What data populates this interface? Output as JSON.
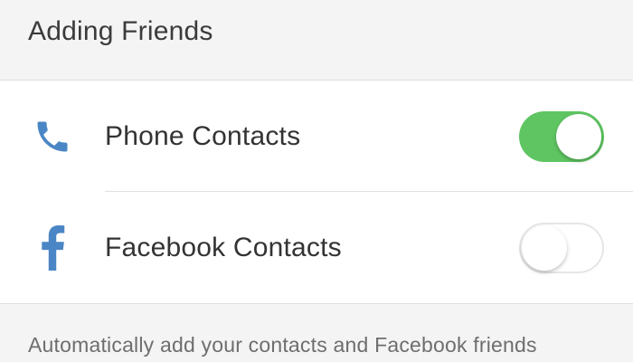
{
  "section": {
    "title": "Adding Friends"
  },
  "rows": [
    {
      "icon": "phone-icon",
      "label": "Phone Contacts",
      "toggle_on": true
    },
    {
      "icon": "facebook-icon",
      "label": "Facebook Contacts",
      "toggle_on": false
    }
  ],
  "footer": {
    "text": "Automatically add your contacts and Facebook friends"
  },
  "colors": {
    "accent_green": "#5fc562",
    "icon_blue": "#4a86c5",
    "background": "#f4f4f4"
  }
}
